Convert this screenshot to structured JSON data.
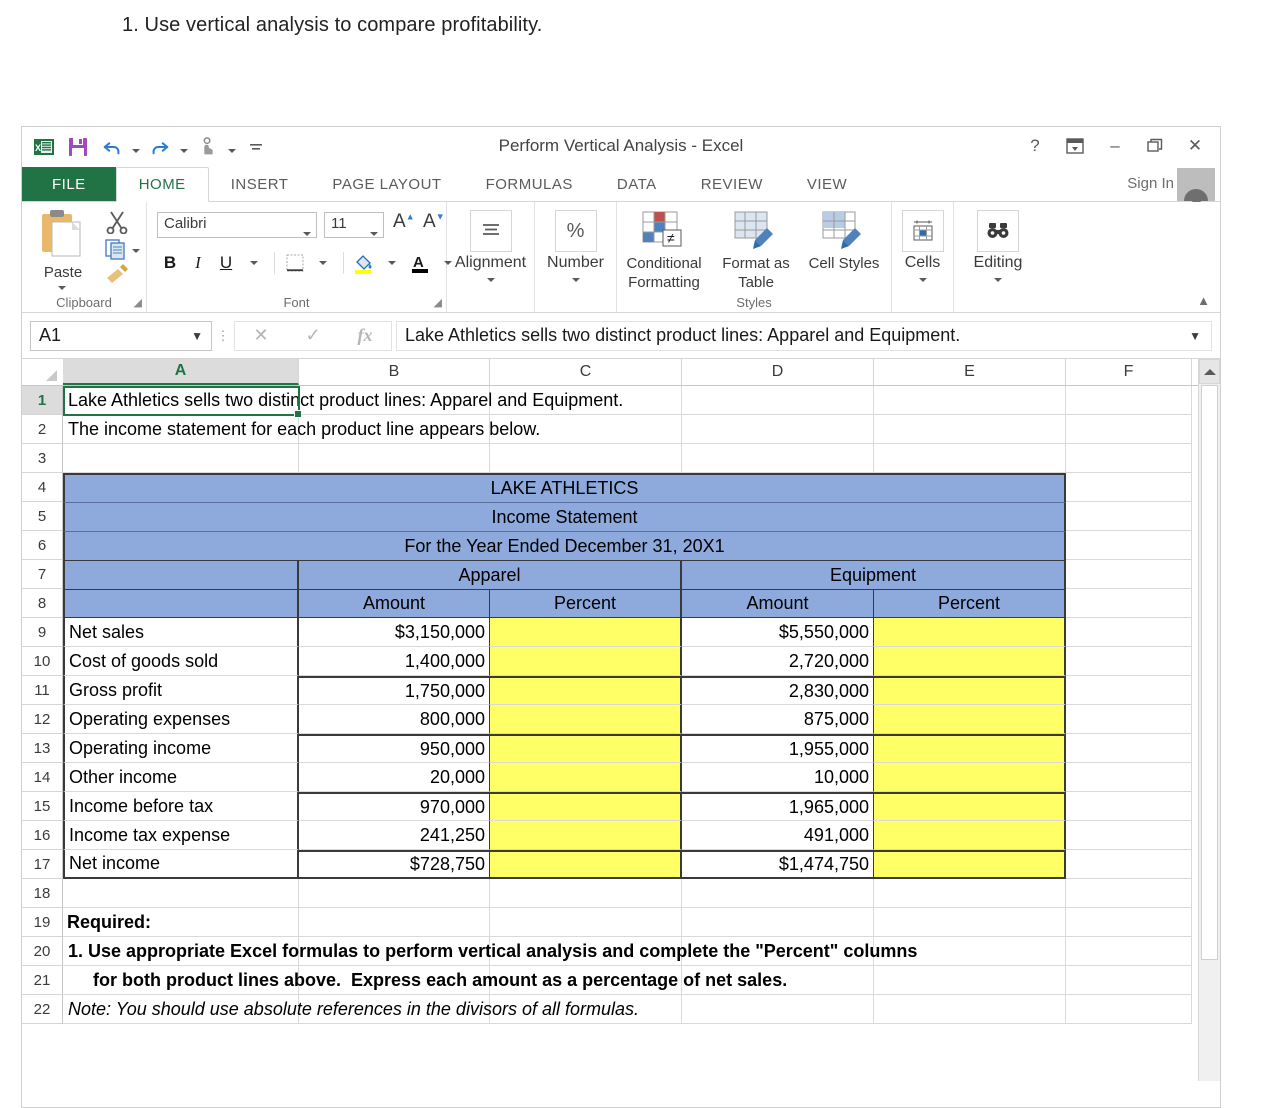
{
  "page": {
    "instruction": "1. Use vertical analysis to compare profitability."
  },
  "window": {
    "title": "Perform Vertical Analysis - Excel",
    "help_label": "?",
    "ribbon_display_label": "ribbon-display-options",
    "minimize_label": "–",
    "restore_label": "❐",
    "close_label": "✕",
    "sign_in_label": "Sign In",
    "quick_access": [
      "excel-logo",
      "save-icon",
      "undo-icon",
      "redo-icon",
      "touch-mode-icon",
      "customize-qat-icon"
    ]
  },
  "ribbon": {
    "tabs": [
      {
        "label": "FILE",
        "state": "file"
      },
      {
        "label": "HOME",
        "state": "active"
      },
      {
        "label": "INSERT",
        "state": "normal"
      },
      {
        "label": "PAGE LAYOUT",
        "state": "normal"
      },
      {
        "label": "FORMULAS",
        "state": "normal"
      },
      {
        "label": "DATA",
        "state": "normal"
      },
      {
        "label": "REVIEW",
        "state": "normal"
      },
      {
        "label": "VIEW",
        "state": "normal"
      }
    ],
    "clipboard": {
      "group_label": "Clipboard",
      "paste_label": "Paste",
      "cut_label": "cut-icon",
      "copy_label": "copy-icon",
      "format_painter_label": "format-painter-icon"
    },
    "font": {
      "group_label": "Font",
      "font_name": "Calibri",
      "font_size": "11",
      "grow_label": "A",
      "shrink_label": "A",
      "bold_label": "B",
      "italic_label": "I",
      "underline_label": "U",
      "borders_label": "borders-icon",
      "fill_color_label": "fill-color-icon",
      "font_color_label": "font-color-icon"
    },
    "alignment": {
      "label": "Alignment"
    },
    "number": {
      "label": "Number",
      "icon": "%"
    },
    "styles": {
      "group_label": "Styles",
      "conditional_formatting": "Conditional Formatting",
      "format_as_table": "Format as Table",
      "cell_styles": "Cell Styles"
    },
    "cells": {
      "label": "Cells"
    },
    "editing": {
      "label": "Editing"
    }
  },
  "formula_bar": {
    "name_box_value": "A1",
    "cancel_label": "✕",
    "enter_label": "✓",
    "insert_function_label": "fx",
    "formula_value": "Lake Athletics sells two distinct product lines:  Apparel and Equipment."
  },
  "grid": {
    "column_headers": [
      "A",
      "B",
      "C",
      "D",
      "E",
      "F"
    ],
    "selected_column": "A",
    "selected_row": "1",
    "row_numbers": [
      "1",
      "2",
      "3",
      "4",
      "5",
      "6",
      "7",
      "8",
      "9",
      "10",
      "11",
      "12",
      "13",
      "14",
      "15",
      "16",
      "17",
      "18",
      "19",
      "20",
      "21",
      "22"
    ],
    "colors": {
      "header_blue": "#8EA9DB",
      "input_yellow": "#FFFF66",
      "selection_green": "#217346"
    },
    "text_rows": {
      "r1": "Lake Athletics sells two distinct product lines:  Apparel and Equipment.",
      "r2": "The income statement for each product line appears below.",
      "title1": "LAKE ATHLETICS",
      "title2": "Income Statement",
      "title3": "For the Year Ended December 31, 20X1",
      "group_apparel": "Apparel",
      "group_equipment": "Equipment",
      "sub_amount_1": "Amount",
      "sub_percent_1": "Percent",
      "sub_amount_2": "Amount",
      "sub_percent_2": "Percent",
      "required": "Required:",
      "req_line1": "1. Use appropriate Excel formulas to perform vertical analysis and complete the \"Percent\" columns",
      "req_line2": "     for both product lines above.  Express each amount as a percentage of net sales.",
      "note": "Note:  You should use absolute references in the divisors of all formulas."
    },
    "statement_rows": [
      {
        "row": "9",
        "label": "Net sales",
        "apparel_amount": "$3,150,000",
        "apparel_percent": "",
        "equipment_amount": "$5,550,000",
        "equipment_percent": "",
        "top_rule": false
      },
      {
        "row": "10",
        "label": "Cost of goods sold",
        "apparel_amount": "1,400,000",
        "apparel_percent": "",
        "equipment_amount": "2,720,000",
        "equipment_percent": "",
        "top_rule": false
      },
      {
        "row": "11",
        "label": "Gross profit",
        "apparel_amount": "1,750,000",
        "apparel_percent": "",
        "equipment_amount": "2,830,000",
        "equipment_percent": "",
        "top_rule": true
      },
      {
        "row": "12",
        "label": "Operating expenses",
        "apparel_amount": "800,000",
        "apparel_percent": "",
        "equipment_amount": "875,000",
        "equipment_percent": "",
        "top_rule": false
      },
      {
        "row": "13",
        "label": "Operating income",
        "apparel_amount": "950,000",
        "apparel_percent": "",
        "equipment_amount": "1,955,000",
        "equipment_percent": "",
        "top_rule": true
      },
      {
        "row": "14",
        "label": "Other income",
        "apparel_amount": "20,000",
        "apparel_percent": "",
        "equipment_amount": "10,000",
        "equipment_percent": "",
        "top_rule": false
      },
      {
        "row": "15",
        "label": "Income before tax",
        "apparel_amount": "970,000",
        "apparel_percent": "",
        "equipment_amount": "1,965,000",
        "equipment_percent": "",
        "top_rule": true
      },
      {
        "row": "16",
        "label": "Income tax expense",
        "apparel_amount": "241,250",
        "apparel_percent": "",
        "equipment_amount": "491,000",
        "equipment_percent": "",
        "top_rule": false
      },
      {
        "row": "17",
        "label": "Net income",
        "apparel_amount": "$728,750",
        "apparel_percent": "",
        "equipment_amount": "$1,474,750",
        "equipment_percent": "",
        "top_rule": true
      }
    ]
  }
}
